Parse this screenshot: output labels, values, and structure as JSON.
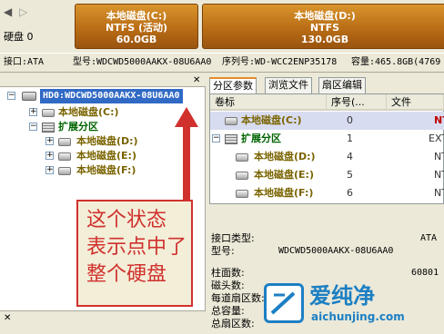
{
  "toolbar": {
    "disk_label": "硬盘 0"
  },
  "partitions_bar": [
    {
      "name": "本地磁盘(C:)",
      "fs": "NTFS (活动)",
      "size": "60.0GB"
    },
    {
      "name": "本地磁盘(D:)",
      "fs": "NTFS",
      "size": "130.0GB"
    }
  ],
  "infoline": {
    "interface": "接口:ATA",
    "model": "型号:WDCWD5000AAKX-08U6AA0",
    "serial": "序列号:WD-WCC2ENP35178",
    "capacity": "容量:465.8GB(4769"
  },
  "tree": {
    "disk": "HD0:WDCWD5000AAKX-08U6AA0",
    "items": [
      {
        "label": "本地磁盘(C:)"
      },
      {
        "label": "扩展分区"
      },
      {
        "label": "本地磁盘(D:)"
      },
      {
        "label": "本地磁盘(E:)"
      },
      {
        "label": "本地磁盘(F:)"
      }
    ]
  },
  "callout": {
    "lines": [
      "这个状态",
      "表示点中了",
      "整个硬盘"
    ]
  },
  "tabs": [
    {
      "label": "分区参数"
    },
    {
      "label": "浏览文件"
    },
    {
      "label": "扇区编辑"
    }
  ],
  "table": {
    "headers": [
      "卷标",
      "序号(...",
      "文件"
    ],
    "rows": [
      {
        "label": "本地磁盘(C:)",
        "seq": "0",
        "fs": "NT"
      },
      {
        "label": "扩展分区",
        "seq": "1",
        "fs": "EXT"
      },
      {
        "label": "本地磁盘(D:)",
        "seq": "4",
        "fs": "NT"
      },
      {
        "label": "本地磁盘(E:)",
        "seq": "5",
        "fs": "NT"
      },
      {
        "label": "本地磁盘(F:)",
        "seq": "6",
        "fs": "NT"
      }
    ]
  },
  "details": {
    "iface_label": "接口类型:",
    "iface_value": "ATA",
    "model_label": "型号:",
    "model_value": "WDCWD5000AAKX-08U6AA0",
    "cyl_label": "柱面数:",
    "cyl_value": "60801",
    "heads_label": "磁头数:",
    "spt_label": "每道扇区数:",
    "cap_label": "总容量:",
    "sectors_label": "总扇区数:"
  },
  "watermark": {
    "brand": "爱纯净",
    "url": "aichunjing.com"
  },
  "colors": {
    "partition_fill": "#b66a14",
    "selection": "#316ac5",
    "callout_red": "#d0312d",
    "watermark_blue": "#1c7fc4"
  }
}
